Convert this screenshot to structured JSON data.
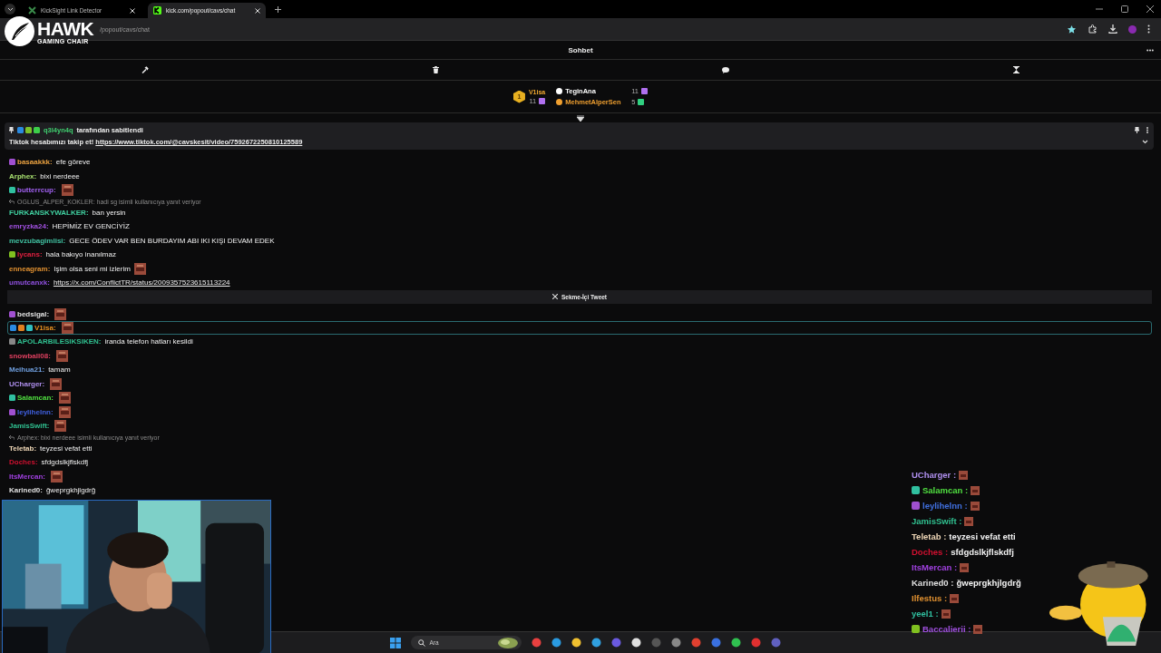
{
  "browser": {
    "tabs": [
      {
        "title": "KickSight Link Detector",
        "selected": false
      },
      {
        "title": "kick.com/popout/cavs/chat",
        "selected": true
      }
    ],
    "address": "/popout/cavs/chat"
  },
  "chat": {
    "title": "Sohbet",
    "leaderboard": {
      "rank": "1",
      "first": {
        "name": "V1isa",
        "count": "11",
        "gift": {
          "color": "#b070f0"
        }
      },
      "others": [
        {
          "name": "TeginAna",
          "count": "11",
          "color": "#ffffff",
          "gift": {
            "color": "#b070f0"
          }
        },
        {
          "name": "MehmetAlperSen",
          "count": "5",
          "color": "#f0a030",
          "gift": {
            "color": "#30d080"
          }
        }
      ]
    },
    "pinned": {
      "badges": [
        {
          "color": "#2a8ae0"
        },
        {
          "color": "#7cc22a"
        },
        {
          "color": "#3ccf4a"
        }
      ],
      "by": "q3l4yn4q",
      "note": "tarafından sabitlendi",
      "text": "Tiktok hesabımızı takip et!",
      "link": "https://www.tiktok.com/@cavskesit/video/7592672250810125589"
    },
    "messages": [
      {
        "kind": "message",
        "user": "basaakkk:",
        "color": "#e8a040",
        "badges": [
          {
            "color": "#a050d0"
          }
        ],
        "text": "efe göreve"
      },
      {
        "kind": "message",
        "user": "Arphex:",
        "color": "#a8e070",
        "text": "bixi nerdeee"
      },
      {
        "kind": "message",
        "user": "butterrcup:",
        "color": "#a060f0",
        "badges": [
          {
            "color": "#30c0a0"
          }
        ],
        "emote": true
      },
      {
        "kind": "reply",
        "text": "OGLUS_ALPER_KOKLER: hadi sg isimli kullanıcıya yanıt veriyor"
      },
      {
        "kind": "message",
        "user": "FURKANSKYWALKER:",
        "color": "#40d0a0",
        "text": "ban yersin"
      },
      {
        "kind": "message",
        "user": "emryzka24:",
        "color": "#a050e0",
        "text": "HEPİMİZ EV GENCİYİZ"
      },
      {
        "kind": "message",
        "user": "mevzubagimlisi:",
        "color": "#40c0a0",
        "text": "GECE ÖDEV VAR BEN BURDAYIM ABI IKI KIŞI DEVAM EDEK"
      },
      {
        "kind": "message",
        "user": "lycans:",
        "color": "#e02040",
        "badges": [
          {
            "color": "#80c020"
          }
        ],
        "text": "hala bakıyo inanılmaz"
      },
      {
        "kind": "message",
        "user": "enneagram:",
        "color": "#e09030",
        "text": "Işim olsa seni mi izlerim",
        "emote": true
      },
      {
        "kind": "message",
        "user": "umutcanxk:",
        "color": "#9050e0",
        "link": "https://x.com/ConflictTR/status/2009357523615113224"
      },
      {
        "kind": "embed",
        "text": "Sekme-İçi Tweet"
      },
      {
        "kind": "message",
        "user": "bedsigal:",
        "color": "#e0e0e0",
        "badges": [
          {
            "color": "#a050d0"
          }
        ],
        "emote": true
      },
      {
        "kind": "message",
        "user": "V1isa:",
        "color": "#e89020",
        "badges": [
          {
            "color": "#2a8ae0"
          },
          {
            "color": "#e08020"
          },
          {
            "color": "#30c0c0"
          }
        ],
        "emote": true,
        "highlighted": true
      },
      {
        "kind": "message",
        "user": "APOLARBILESIKSIKEN:",
        "color": "#30c090",
        "badges": [
          {
            "color": "#888888"
          }
        ],
        "text": "iranda telefon hatları kesildi"
      },
      {
        "kind": "message",
        "user": "snowball08:",
        "color": "#e04060",
        "emote": true
      },
      {
        "kind": "message",
        "user": "Meihua21:",
        "color": "#70a0e0",
        "text": "tamam"
      },
      {
        "kind": "message",
        "user": "UCharger:",
        "color": "#b090f0",
        "emote": true
      },
      {
        "kind": "message",
        "user": "Salamcan:",
        "color": "#50e040",
        "badges": [
          {
            "color": "#30c0a0"
          }
        ],
        "emote": true
      },
      {
        "kind": "message",
        "user": "leylihelnn:",
        "color": "#4060e0",
        "badges": [
          {
            "color": "#a050d0"
          }
        ],
        "emote": true
      },
      {
        "kind": "message",
        "user": "JamisSwift:",
        "color": "#30c090",
        "emote": true
      },
      {
        "kind": "reply",
        "text": "Arphex: bixi nerdeee isimli kullanıcıya yanıt veriyor"
      },
      {
        "kind": "message",
        "user": "Teletab:",
        "color": "#f0d8b8",
        "text": "teyzesi vefat etti"
      },
      {
        "kind": "message",
        "user": "Doches:",
        "color": "#d01030",
        "text": "sfdgdslkjflskdfj"
      },
      {
        "kind": "message",
        "user": "ItsMercan:",
        "color": "#a040e0",
        "emote": true
      },
      {
        "kind": "message",
        "user": "Karined0:",
        "color": "#e0e0e0",
        "text": "ğweprgkhjlgdrğ"
      }
    ]
  },
  "overlay": {
    "logo": {
      "name": "HAWK",
      "tagline": "GAMING CHAIR"
    },
    "chat": [
      {
        "user": "UCharger :",
        "color": "#b090f0",
        "emote": true
      },
      {
        "user": "Salamcan :",
        "color": "#50e040",
        "badges": [
          {
            "color": "#30c0a0"
          }
        ],
        "emote": true
      },
      {
        "user": "leylihelnn :",
        "color": "#4070e0",
        "badges": [
          {
            "color": "#a050d0"
          }
        ],
        "emote": true
      },
      {
        "user": "JamisSwift :",
        "color": "#30c090",
        "emote": true
      },
      {
        "user": "Teletab :",
        "color": "#f0d8b8",
        "text": "teyzesi vefat etti"
      },
      {
        "user": "Doches :",
        "color": "#d01030",
        "text": "sfdgdslkjflskdfj"
      },
      {
        "user": "ItsMercan :",
        "color": "#a040e0",
        "emote": true
      },
      {
        "user": "Karined0 :",
        "color": "#e0e0e0",
        "text": "ğweprgkhjlgdrğ"
      },
      {
        "user": "Ilfestus :",
        "color": "#e09030",
        "emote": true
      },
      {
        "user": "yeel1 :",
        "color": "#30c0a0",
        "emote": true
      },
      {
        "user": "Baccalierii :",
        "color": "#a050e0",
        "badges": [
          {
            "color": "#80c020"
          }
        ],
        "emote": true
      }
    ]
  },
  "taskbar": {
    "search": "Ara"
  }
}
